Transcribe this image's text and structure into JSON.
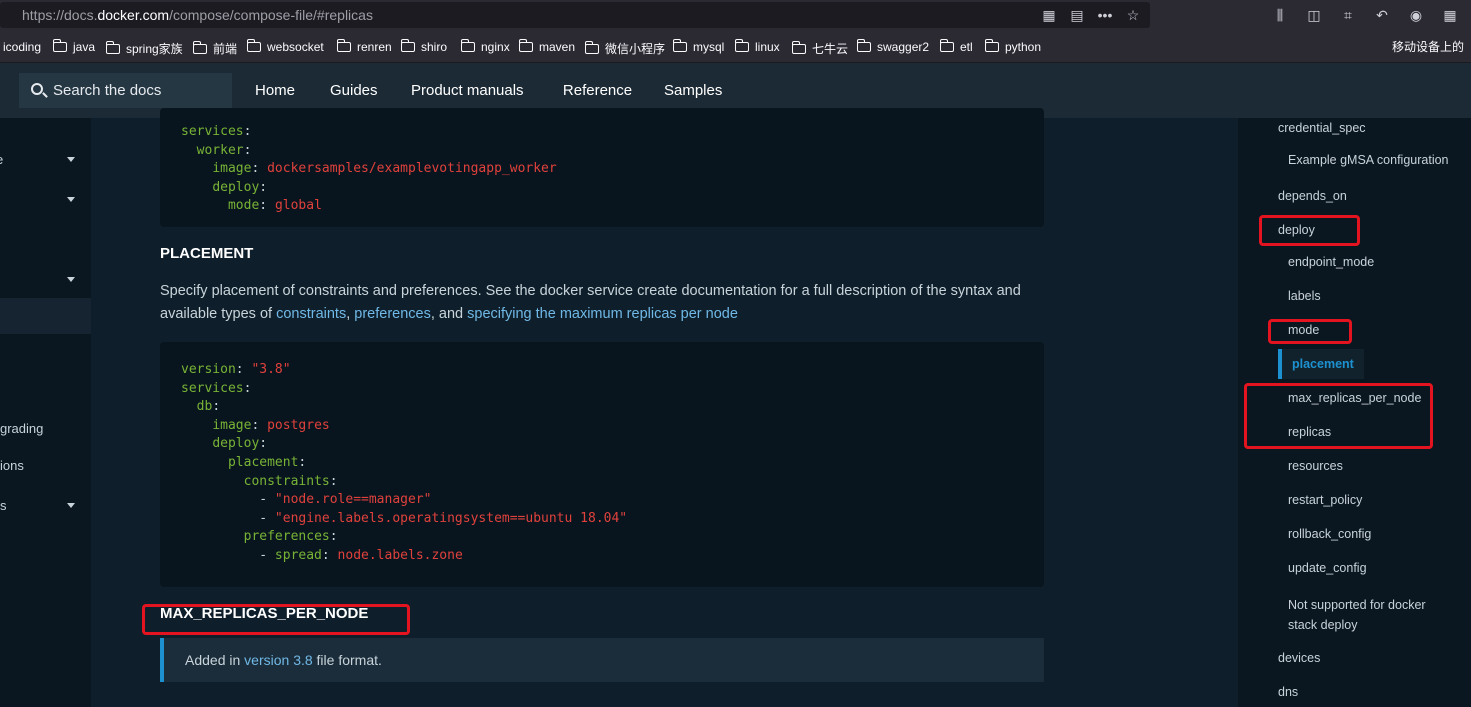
{
  "browser": {
    "url_scheme": "https://docs.",
    "url_host": "docker.com",
    "url_path": "/compose/compose-file/#replicas",
    "more_label": "•••",
    "bookmarks": [
      {
        "label": "icoding",
        "folder": false
      },
      {
        "label": "java",
        "folder": true
      },
      {
        "label": "spring家族",
        "folder": true
      },
      {
        "label": "前端",
        "folder": true
      },
      {
        "label": "websocket",
        "folder": true
      },
      {
        "label": "renren",
        "folder": true
      },
      {
        "label": "shiro",
        "folder": true
      },
      {
        "label": "nginx",
        "folder": true
      },
      {
        "label": "maven",
        "folder": true
      },
      {
        "label": "微信小程序",
        "folder": true
      },
      {
        "label": "mysql",
        "folder": true
      },
      {
        "label": "linux",
        "folder": true
      },
      {
        "label": "七牛云",
        "folder": true
      },
      {
        "label": "swagger2",
        "folder": true
      },
      {
        "label": "etl",
        "folder": true
      },
      {
        "label": "python",
        "folder": true
      }
    ],
    "mobile_bookmarks": "移动设备上的"
  },
  "nav": {
    "search_placeholder": "Search the docs",
    "links": [
      "Home",
      "Guides",
      "Product manuals",
      "Reference",
      "Samples"
    ],
    "active": "Reference"
  },
  "left_sidebar": {
    "items": [
      "e",
      "grading",
      "ions",
      "s"
    ]
  },
  "content": {
    "code1": [
      [
        [
          "k",
          "services"
        ],
        [
          "p",
          ":"
        ]
      ],
      [
        [
          "p",
          "  "
        ],
        [
          "k",
          "worker"
        ],
        [
          "p",
          ":"
        ]
      ],
      [
        [
          "p",
          "    "
        ],
        [
          "k",
          "image"
        ],
        [
          "p",
          ": "
        ],
        [
          "s",
          "dockersamples/examplevotingapp_worker"
        ]
      ],
      [
        [
          "p",
          "    "
        ],
        [
          "k",
          "deploy"
        ],
        [
          "p",
          ":"
        ]
      ],
      [
        [
          "p",
          "      "
        ],
        [
          "k",
          "mode"
        ],
        [
          "p",
          ": "
        ],
        [
          "s",
          "global"
        ]
      ]
    ],
    "placement_heading": "PLACEMENT",
    "placement_text": "Specify placement of constraints and preferences. See the docker service create documentation for a full description of the syntax and available types of",
    "placement_links": [
      "constraints",
      "preferences",
      "specifying the maximum replicas per node"
    ],
    "comma": ",",
    "and_text": ", and",
    "code2": [
      [
        [
          "k",
          "version"
        ],
        [
          "p",
          ": "
        ],
        [
          "s",
          "\"3.8\""
        ]
      ],
      [
        [
          "k",
          "services"
        ],
        [
          "p",
          ":"
        ]
      ],
      [
        [
          "p",
          "  "
        ],
        [
          "k",
          "db"
        ],
        [
          "p",
          ":"
        ]
      ],
      [
        [
          "p",
          "    "
        ],
        [
          "k",
          "image"
        ],
        [
          "p",
          ": "
        ],
        [
          "s",
          "postgres"
        ]
      ],
      [
        [
          "p",
          "    "
        ],
        [
          "k",
          "deploy"
        ],
        [
          "p",
          ":"
        ]
      ],
      [
        [
          "p",
          "      "
        ],
        [
          "k",
          "placement"
        ],
        [
          "p",
          ":"
        ]
      ],
      [
        [
          "p",
          "        "
        ],
        [
          "k",
          "constraints"
        ],
        [
          "p",
          ":"
        ]
      ],
      [
        [
          "p",
          "          - "
        ],
        [
          "s",
          "\"node.role==manager\""
        ]
      ],
      [
        [
          "p",
          "          - "
        ],
        [
          "s",
          "\"engine.labels.operatingsystem==ubuntu 18.04\""
        ]
      ],
      [
        [
          "p",
          "        "
        ],
        [
          "k",
          "preferences"
        ],
        [
          "p",
          ":"
        ]
      ],
      [
        [
          "p",
          "          - "
        ],
        [
          "k",
          "spread"
        ],
        [
          "p",
          ": "
        ],
        [
          "s",
          "node.labels.zone"
        ]
      ]
    ],
    "max_replicas_heading": "MAX_REPLICAS_PER_NODE",
    "note_prefix": "Added in",
    "note_link": "version 3.8",
    "note_suffix": "file format."
  },
  "toc": {
    "items": [
      {
        "label": "credential_spec",
        "indent": 0
      },
      {
        "label": "Example gMSA configuration",
        "indent": 1
      },
      {
        "label": "depends_on",
        "indent": 0
      },
      {
        "label": "deploy",
        "indent": 0
      },
      {
        "label": "endpoint_mode",
        "indent": 1
      },
      {
        "label": "labels",
        "indent": 1
      },
      {
        "label": "mode",
        "indent": 1
      },
      {
        "label": "placement",
        "indent": 1,
        "active": true
      },
      {
        "label": "max_replicas_per_node",
        "indent": 1
      },
      {
        "label": "replicas",
        "indent": 1
      },
      {
        "label": "resources",
        "indent": 1
      },
      {
        "label": "restart_policy",
        "indent": 1
      },
      {
        "label": "rollback_config",
        "indent": 1
      },
      {
        "label": "update_config",
        "indent": 1
      },
      {
        "label": "Not supported for docker stack deploy",
        "indent": 1
      },
      {
        "label": "devices",
        "indent": 0
      },
      {
        "label": "dns",
        "indent": 0
      }
    ]
  },
  "colors": {
    "accent": "#1d91d0",
    "highlight_box": "#e3141f",
    "code_key": "#78b336",
    "code_string": "#e0413c"
  }
}
